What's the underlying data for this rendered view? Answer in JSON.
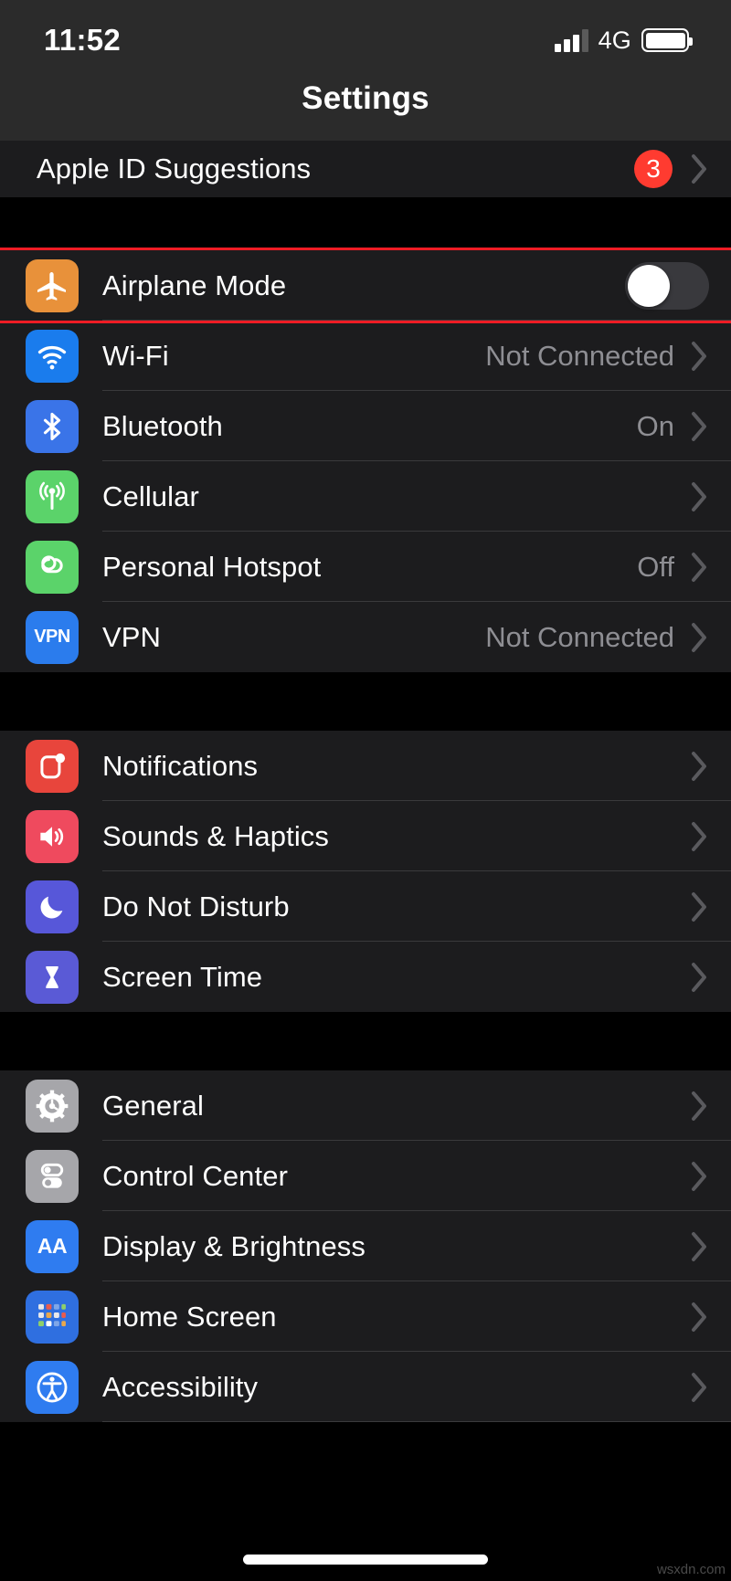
{
  "status_bar": {
    "time": "11:52",
    "network_type": "4G",
    "signal_icon": "signal-bars-icon",
    "battery_icon": "battery-full-icon",
    "signal_bars_active": 3,
    "signal_bars_total": 4
  },
  "nav": {
    "title": "Settings"
  },
  "colors": {
    "airplane": "#e8913a",
    "wifi": "#1a7ced",
    "bluetooth": "#3a74e8",
    "cellular": "#5bd36a",
    "hotspot": "#5bd36a",
    "vpn": "#2b7ced",
    "notifications": "#e8453c",
    "sounds": "#ef4a5e",
    "dnd": "#5757d9",
    "screentime": "#5a5ad6",
    "general": "#a6a6aa",
    "control_center": "#a6a6aa",
    "display": "#2f7cf0",
    "home_screen": "#2f6fe0",
    "accessibility": "#2f7cf0",
    "badge": "#ff3b30",
    "highlight": "#ee1c25",
    "toggle_off_track": "#39393d"
  },
  "groups": [
    {
      "name": "apple-id-group",
      "rows": [
        {
          "name": "apple-id-suggestions",
          "label": "Apple ID Suggestions",
          "badge": "3",
          "accessory": "chevron",
          "icon": null
        }
      ]
    },
    {
      "name": "connectivity-group",
      "rows": [
        {
          "name": "airplane-mode",
          "label": "Airplane Mode",
          "icon": "airplane-icon",
          "accessory": "toggle",
          "toggle_on": false,
          "highlighted": true
        },
        {
          "name": "wi-fi",
          "label": "Wi-Fi",
          "value": "Not Connected",
          "icon": "wifi-icon",
          "accessory": "chevron"
        },
        {
          "name": "bluetooth",
          "label": "Bluetooth",
          "value": "On",
          "icon": "bluetooth-icon",
          "accessory": "chevron"
        },
        {
          "name": "cellular",
          "label": "Cellular",
          "value": "",
          "icon": "cellular-antenna-icon",
          "accessory": "chevron"
        },
        {
          "name": "personal-hotspot",
          "label": "Personal Hotspot",
          "value": "Off",
          "icon": "hotspot-link-icon",
          "accessory": "chevron"
        },
        {
          "name": "vpn",
          "label": "VPN",
          "value": "Not Connected",
          "icon": "vpn-icon",
          "icon_text": "VPN",
          "accessory": "chevron"
        }
      ]
    },
    {
      "name": "notifications-group",
      "rows": [
        {
          "name": "notifications",
          "label": "Notifications",
          "icon": "notifications-icon",
          "accessory": "chevron"
        },
        {
          "name": "sounds-haptics",
          "label": "Sounds & Haptics",
          "icon": "speaker-icon",
          "accessory": "chevron"
        },
        {
          "name": "do-not-disturb",
          "label": "Do Not Disturb",
          "icon": "moon-icon",
          "accessory": "chevron"
        },
        {
          "name": "screen-time",
          "label": "Screen Time",
          "icon": "hourglass-icon",
          "accessory": "chevron"
        }
      ]
    },
    {
      "name": "general-group",
      "rows": [
        {
          "name": "general",
          "label": "General",
          "icon": "gear-icon",
          "accessory": "chevron"
        },
        {
          "name": "control-center",
          "label": "Control Center",
          "icon": "control-center-icon",
          "accessory": "chevron"
        },
        {
          "name": "display-brightness",
          "label": "Display & Brightness",
          "icon": "display-aa-icon",
          "icon_text": "AA",
          "accessory": "chevron"
        },
        {
          "name": "home-screen",
          "label": "Home Screen",
          "icon": "home-screen-grid-icon",
          "accessory": "chevron"
        },
        {
          "name": "accessibility",
          "label": "Accessibility",
          "icon": "accessibility-icon",
          "accessory": "chevron"
        }
      ]
    }
  ],
  "home_indicator": "home-indicator",
  "watermark": "wsxdn.com"
}
